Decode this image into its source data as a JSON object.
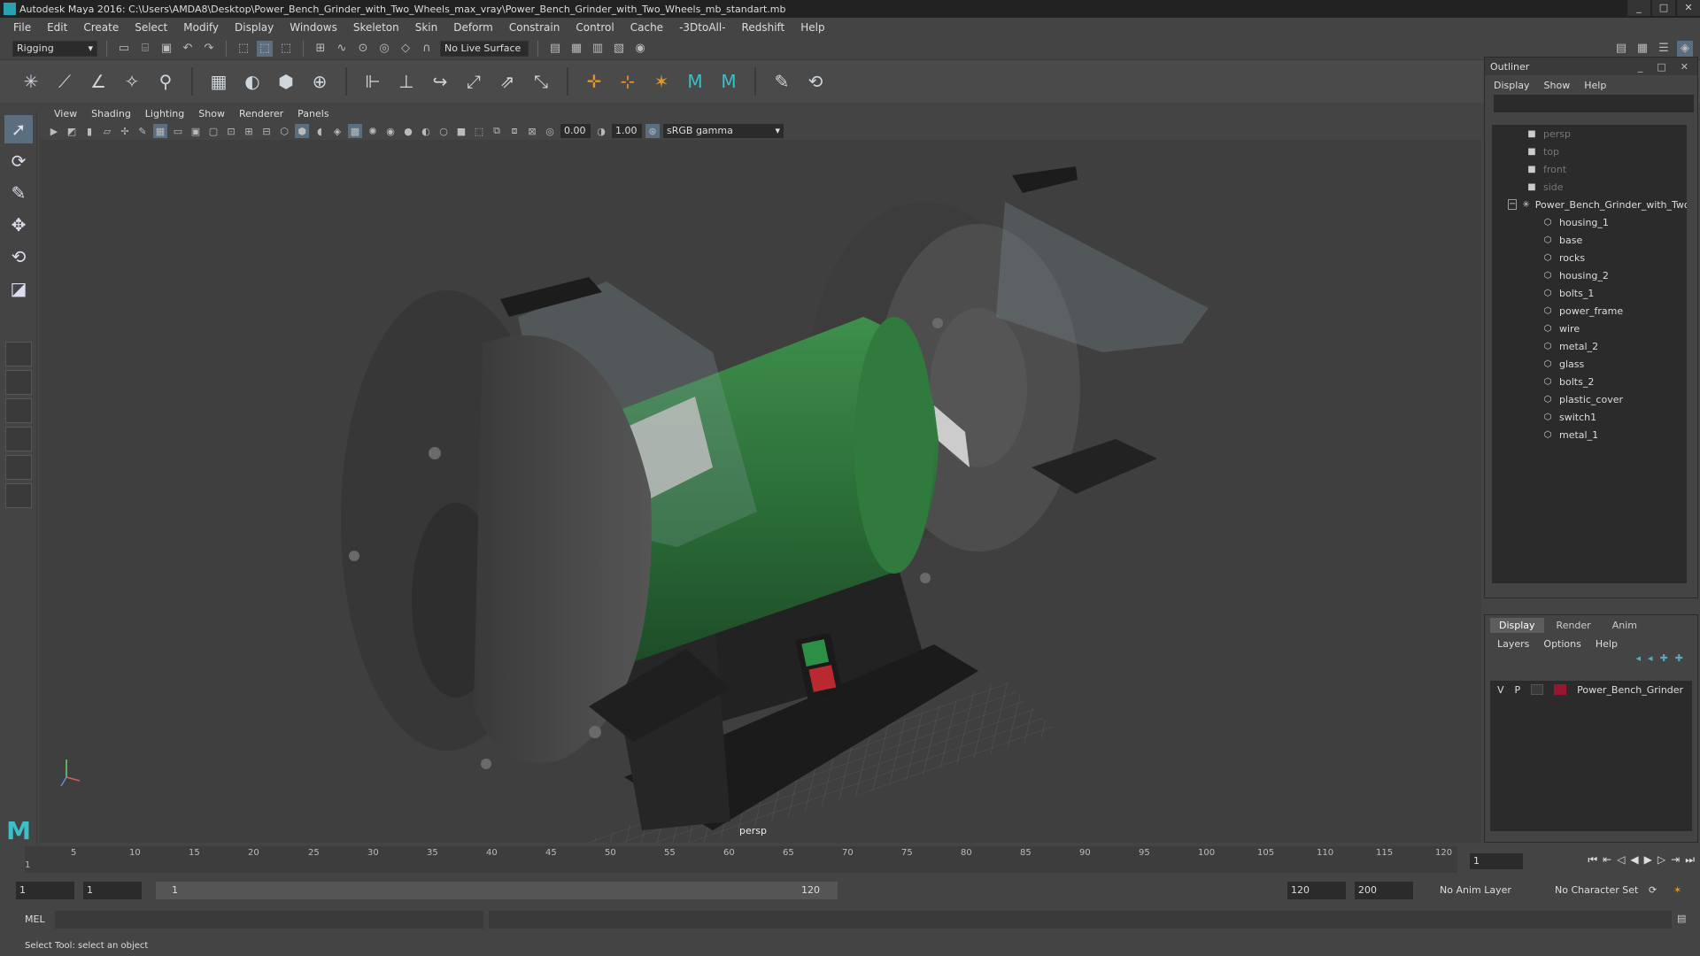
{
  "window": {
    "title": "Autodesk Maya 2016: C:\\Users\\AMDA8\\Desktop\\Power_Bench_Grinder_with_Two_Wheels_max_vray\\Power_Bench_Grinder_with_Two_Wheels_mb_standart.mb",
    "minimize": "_",
    "maximize": "□",
    "close": "✕"
  },
  "menubar": [
    "File",
    "Edit",
    "Create",
    "Select",
    "Modify",
    "Display",
    "Windows",
    "Skeleton",
    "Skin",
    "Deform",
    "Constrain",
    "Control",
    "Cache",
    "-3DtoAll-",
    "Redshift",
    "Help"
  ],
  "statusline": {
    "menuset": "Rigging",
    "live_surface": "No Live Surface"
  },
  "viewport": {
    "menu": [
      "View",
      "Shading",
      "Lighting",
      "Show",
      "Renderer",
      "Panels"
    ],
    "near_value": "0.00",
    "far_value": "1.00",
    "color_space": "sRGB gamma",
    "camera_label": "persp"
  },
  "outliner": {
    "title": "Outliner",
    "menu": [
      "Display",
      "Show",
      "Help"
    ],
    "cameras": [
      "persp",
      "top",
      "front",
      "side"
    ],
    "root": "Power_Bench_Grinder_with_Two_Wheels",
    "children": [
      "housing_1",
      "base",
      "rocks",
      "housing_2",
      "bolts_1",
      "power_frame",
      "wire",
      "metal_2",
      "glass",
      "bolts_2",
      "plastic_cover",
      "switch1",
      "metal_1"
    ]
  },
  "layers": {
    "tabs": [
      "Display",
      "Render",
      "Anim"
    ],
    "active_tab": "Display",
    "menu": [
      "Layers",
      "Options",
      "Help"
    ],
    "rows": [
      {
        "v": "V",
        "p": "P",
        "name": "Power_Bench_Grinder",
        "color": "#9a1530"
      }
    ]
  },
  "timeline": {
    "ticks": [
      "1",
      "5",
      "10",
      "15",
      "20",
      "25",
      "30",
      "35",
      "40",
      "45",
      "50",
      "55",
      "60",
      "65",
      "70",
      "75",
      "80",
      "85",
      "90",
      "95",
      "100",
      "105",
      "110",
      "115",
      "120"
    ],
    "current_frame": "1"
  },
  "range": {
    "start_frame": "1",
    "start_range": "1",
    "slider_start": "1",
    "slider_end": "120",
    "end_range": "120",
    "end_frame": "200",
    "anim_layer": "No Anim Layer",
    "character_set": "No Character Set"
  },
  "command": {
    "label": "MEL"
  },
  "help_line": "Select Tool: select an object",
  "colors": {
    "accent": "#5a6e80",
    "layer_color": "#9a1530",
    "motor": "#2f7a3c"
  }
}
